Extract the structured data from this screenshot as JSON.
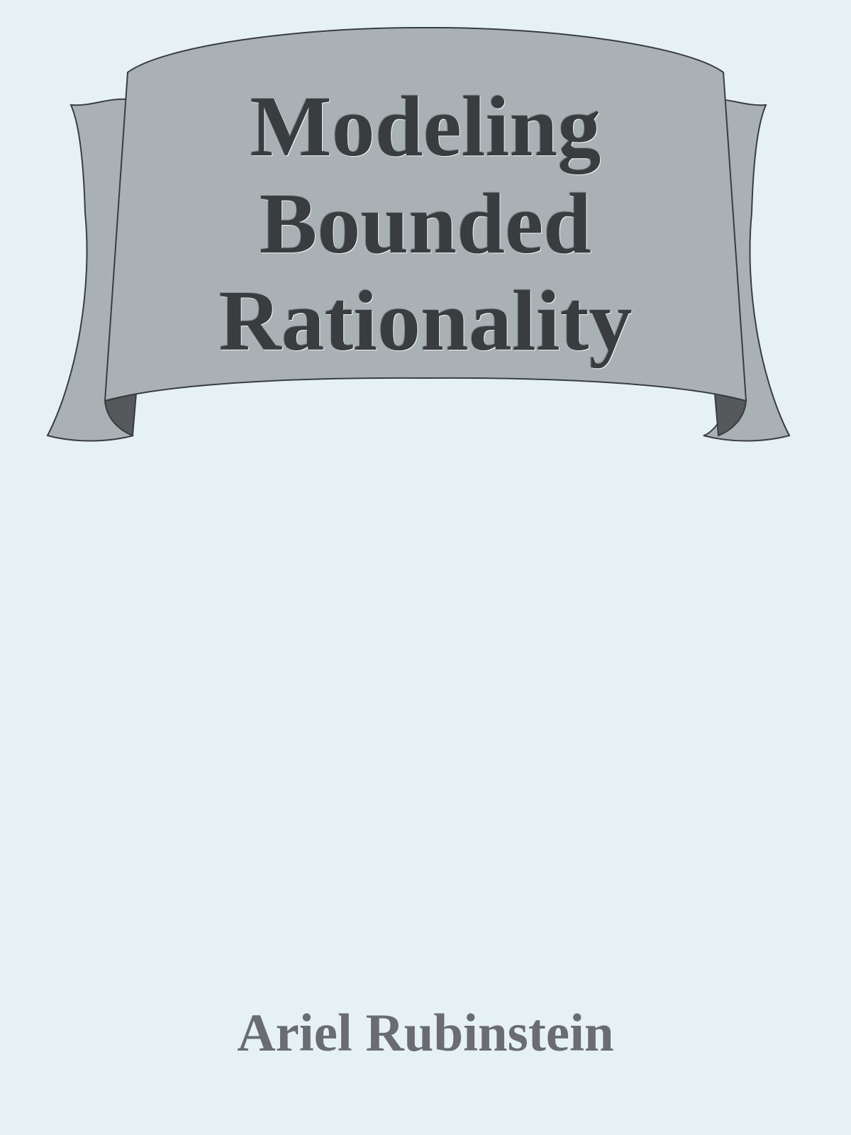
{
  "cover": {
    "title_lines": [
      "Modeling",
      "Bounded",
      "Rationality"
    ],
    "author": "Ariel Rubinstein"
  },
  "colors": {
    "background": "#e6f1f6",
    "banner_fill": "#a9b1b4",
    "banner_fold": "#55595c",
    "banner_stroke": "#393d40",
    "title_text": "#393d40",
    "author_text": "#696d70"
  },
  "icons": {
    "banner": "ribbon-banner"
  }
}
